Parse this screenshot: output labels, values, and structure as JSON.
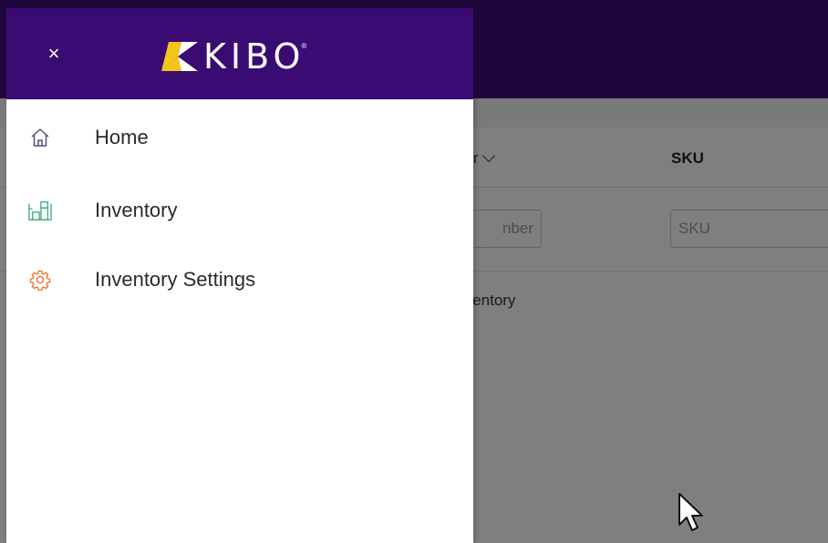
{
  "drawer": {
    "close_label": "×",
    "logo_text": "KIBO",
    "logo_tm": "®",
    "nav_items": [
      {
        "label": "Home",
        "icon": "home-icon",
        "icon_color": "#5a4a7a"
      },
      {
        "label": "Inventory",
        "icon": "inventory-icon",
        "icon_color": "#4caf7a"
      },
      {
        "label": "Inventory Settings",
        "icon": "gear-icon",
        "icon_color": "#f07a3a"
      }
    ]
  },
  "background": {
    "columns": [
      "ber",
      "SKU"
    ],
    "filters": {
      "number_placeholder": "nber",
      "sku_placeholder": "SKU"
    },
    "empty_message": "ew inventory"
  },
  "colors": {
    "header_purple": "#3a0b72",
    "logo_yellow": "#f5c518"
  }
}
